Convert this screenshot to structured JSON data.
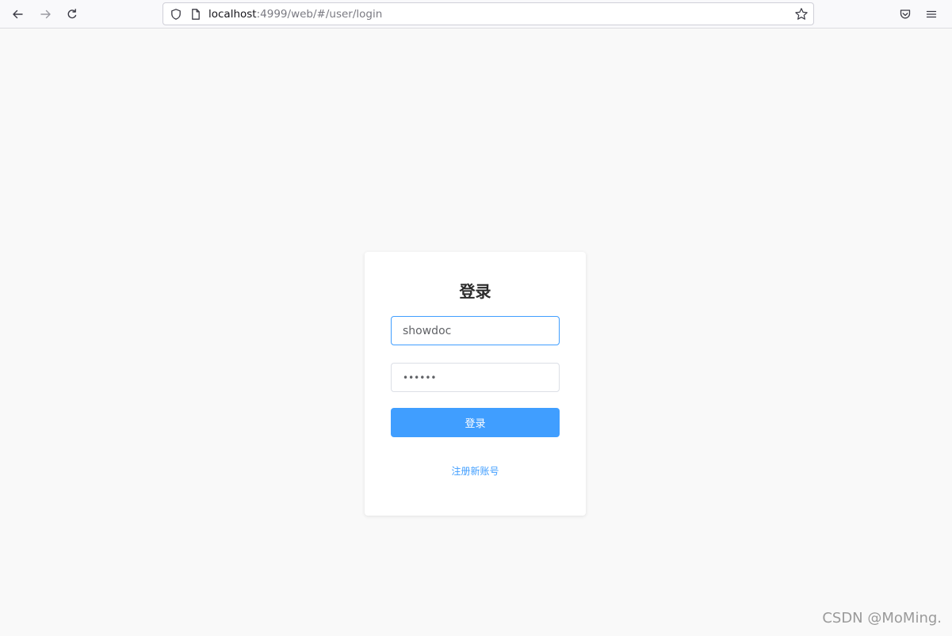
{
  "browser": {
    "url_host": "localhost",
    "url_rest": ":4999/web/#/user/login",
    "icons": {
      "back": "back-arrow-icon",
      "forward": "forward-arrow-icon",
      "reload": "reload-icon",
      "shield": "tracking-protection-shield-icon",
      "page": "page-info-icon",
      "bookmark": "bookmark-star-icon",
      "pocket": "pocket-icon",
      "menu": "hamburger-menu-icon"
    }
  },
  "login": {
    "title": "登录",
    "username_value": "showdoc",
    "password_value": "••••••",
    "submit_label": "登录",
    "register_label": "注册新账号"
  },
  "watermark": "CSDN @MoMing.",
  "colors": {
    "primary": "#409eff",
    "page_bg": "#f9f9f9",
    "card_bg": "#ffffff"
  }
}
